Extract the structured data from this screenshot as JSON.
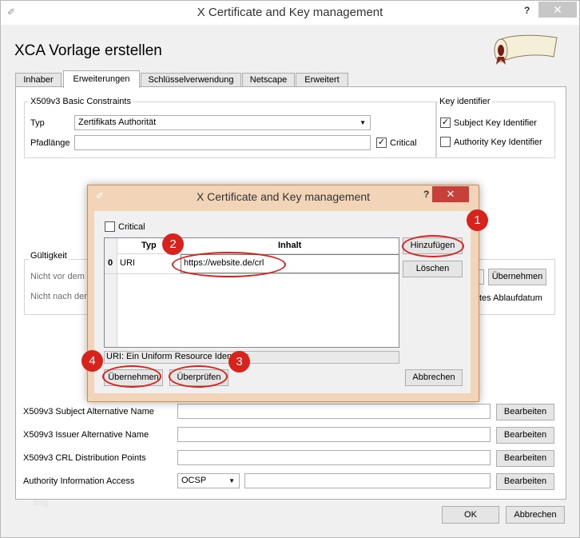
{
  "window": {
    "title": "X Certificate and Key management",
    "help": "?",
    "close": "✕",
    "heading": "XCA Vorlage erstellen"
  },
  "tabs": [
    "Inhaber",
    "Erweiterungen",
    "Schlüsselverwendung",
    "Netscape",
    "Erweitert"
  ],
  "basic_constraints": {
    "group": "X509v3 Basic Constraints",
    "typ_label": "Typ",
    "typ_value": "Zertifikats Authorität",
    "pfad_label": "Pfadlänge",
    "critical": "Critical"
  },
  "key_identifier": {
    "group": "Key identifier",
    "subject": "Subject Key Identifier",
    "authority": "Authority Key Identifier"
  },
  "validity": {
    "group": "Gültigkeit",
    "not_before": "Nicht vor dem",
    "not_after": "Nicht nach dem",
    "apply": "Übernehmen",
    "expiry_tail": "tes Ablaufdatum"
  },
  "extensions": [
    {
      "label": "X509v3 Subject Alternative Name",
      "button": "Bearbeiten"
    },
    {
      "label": "X509v3 Issuer Alternative Name",
      "button": "Bearbeiten"
    },
    {
      "label": "X509v3 CRL Distribution Points",
      "button": "Bearbeiten"
    },
    {
      "label": "Authority Information Access",
      "button": "Bearbeiten",
      "combo": "OCSP"
    }
  ],
  "watermark": "Blog",
  "footer": {
    "ok": "OK",
    "cancel": "Abbrechen"
  },
  "dialog": {
    "title": "X Certificate and Key management",
    "help": "?",
    "close": "✕",
    "critical": "Critical",
    "columns": [
      "Typ",
      "Inhalt"
    ],
    "row": {
      "index": "0",
      "type": "URI",
      "content": "https://website.de/crl"
    },
    "add": "Hinzufügen",
    "delete": "Löschen",
    "status": "URI: Ein Uniform Resource Identifier",
    "apply": "Übernehmen",
    "validate": "Überprüfen",
    "cancel": "Abbrechen"
  },
  "markers": [
    "1",
    "2",
    "3",
    "4"
  ],
  "colors": {
    "marker": "#d8221c",
    "dialog_frame": "#f2d5b8"
  }
}
